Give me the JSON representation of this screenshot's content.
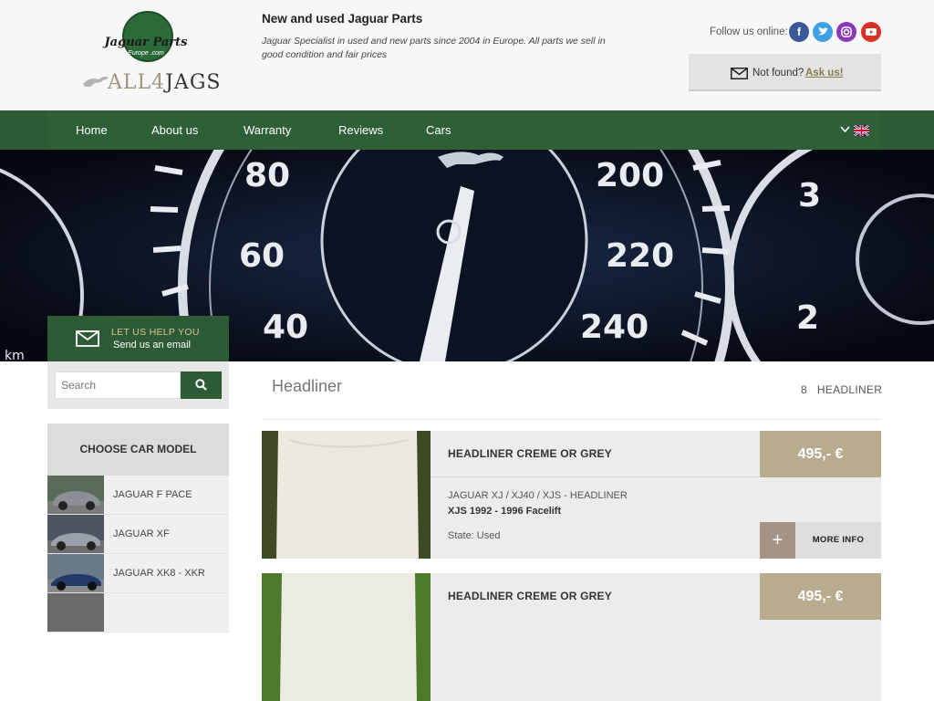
{
  "header": {
    "logo_text": "Jaguar Parts",
    "logo_sub": "Europe .com",
    "brand_all4": "ALL4",
    "brand_jags": "JAGS",
    "tag_title": "New and used Jaguar Parts",
    "tag_desc": "Jaguar Specialist in used and new parts since 2004 in Europe. All parts we sell in good condition and fair prices",
    "follow_label": "Follow us online:",
    "social": [
      "facebook-icon",
      "twitter-icon",
      "instagram-icon",
      "youtube-icon"
    ],
    "not_found_label": "Not found?",
    "ask_us": "Ask us!"
  },
  "nav": {
    "items": [
      "Home",
      "About us",
      "Warranty",
      "Reviews",
      "Cars"
    ],
    "lang_chevron": "⌄"
  },
  "hero": {
    "gauge_numbers": [
      "80",
      "60",
      "40",
      "200",
      "220",
      "240",
      "3",
      "2"
    ],
    "unit_label": "km"
  },
  "help": {
    "title": "LET US HELP YOU",
    "sub": "Send us an email"
  },
  "sidebar": {
    "search_placeholder": "Search",
    "choose_title": "CHOOSE CAR MODEL",
    "cars": [
      "JAGUAR F PACE",
      "JAGUAR XF",
      "JAGUAR XK8 - XKR"
    ]
  },
  "main": {
    "title": "Headliner",
    "count": "8",
    "count_label": "HEADLINER",
    "products": [
      {
        "title": "HEADLINER CREME OR GREY",
        "price": "495,- €",
        "model": "JAGUAR XJ / XJ40 / XJS - HEADLINER",
        "sub": "XJS 1992 - 1996 Facelift",
        "state": "State: Used",
        "plus": "+",
        "more": "MORE INFO"
      },
      {
        "title": "HEADLINER CREME OR GREY",
        "price": "495,- €"
      }
    ]
  },
  "colors": {
    "nav_green": "#2e5b35",
    "price_tan": "#b9ac8e",
    "help_gold": "#d3c48e"
  }
}
